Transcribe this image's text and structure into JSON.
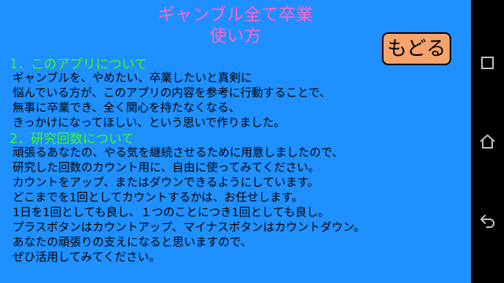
{
  "app": {
    "title_line1": "ギャンブル全て卒業",
    "title_line2": "使い方",
    "back_button_label": "もどる",
    "colors": {
      "background": "#1e90ff",
      "title": "#ff66cc",
      "heading": "#39ff14",
      "button": "#f6a36c"
    }
  },
  "sections": [
    {
      "heading": "1．このアプリについて",
      "lines": [
        "ギャンブルを、やめたい、卒業したいと真剣に",
        "悩んでいる方が、このアプリの内容を参考に行動することで、",
        "無事に卒業でき、全く関心を持たなくなる、",
        "きっかけになってほしい、という思いで作りました。"
      ]
    },
    {
      "heading": "2．研究回数について",
      "lines": [
        "頑張るあなたの、やる気を継続させるために用意しましたので、",
        "研究した回数のカウント用に、自由に使ってみてください。",
        "カウントをアップ、またはダウンできるようにしています。",
        "どこまでを1回としてカウントするかは、お任せします。",
        "1日を1回としても良し、１つのことにつき1回としても良し。",
        "プラスボタンはカウントアップ、マイナスボタンはカウントダウン。",
        "あなたの頑張りの支えになると思いますので、",
        "ぜひ活用してみてください。"
      ]
    }
  ],
  "system_nav": {
    "icons": [
      "recent-apps-icon",
      "home-icon",
      "back-icon"
    ]
  }
}
